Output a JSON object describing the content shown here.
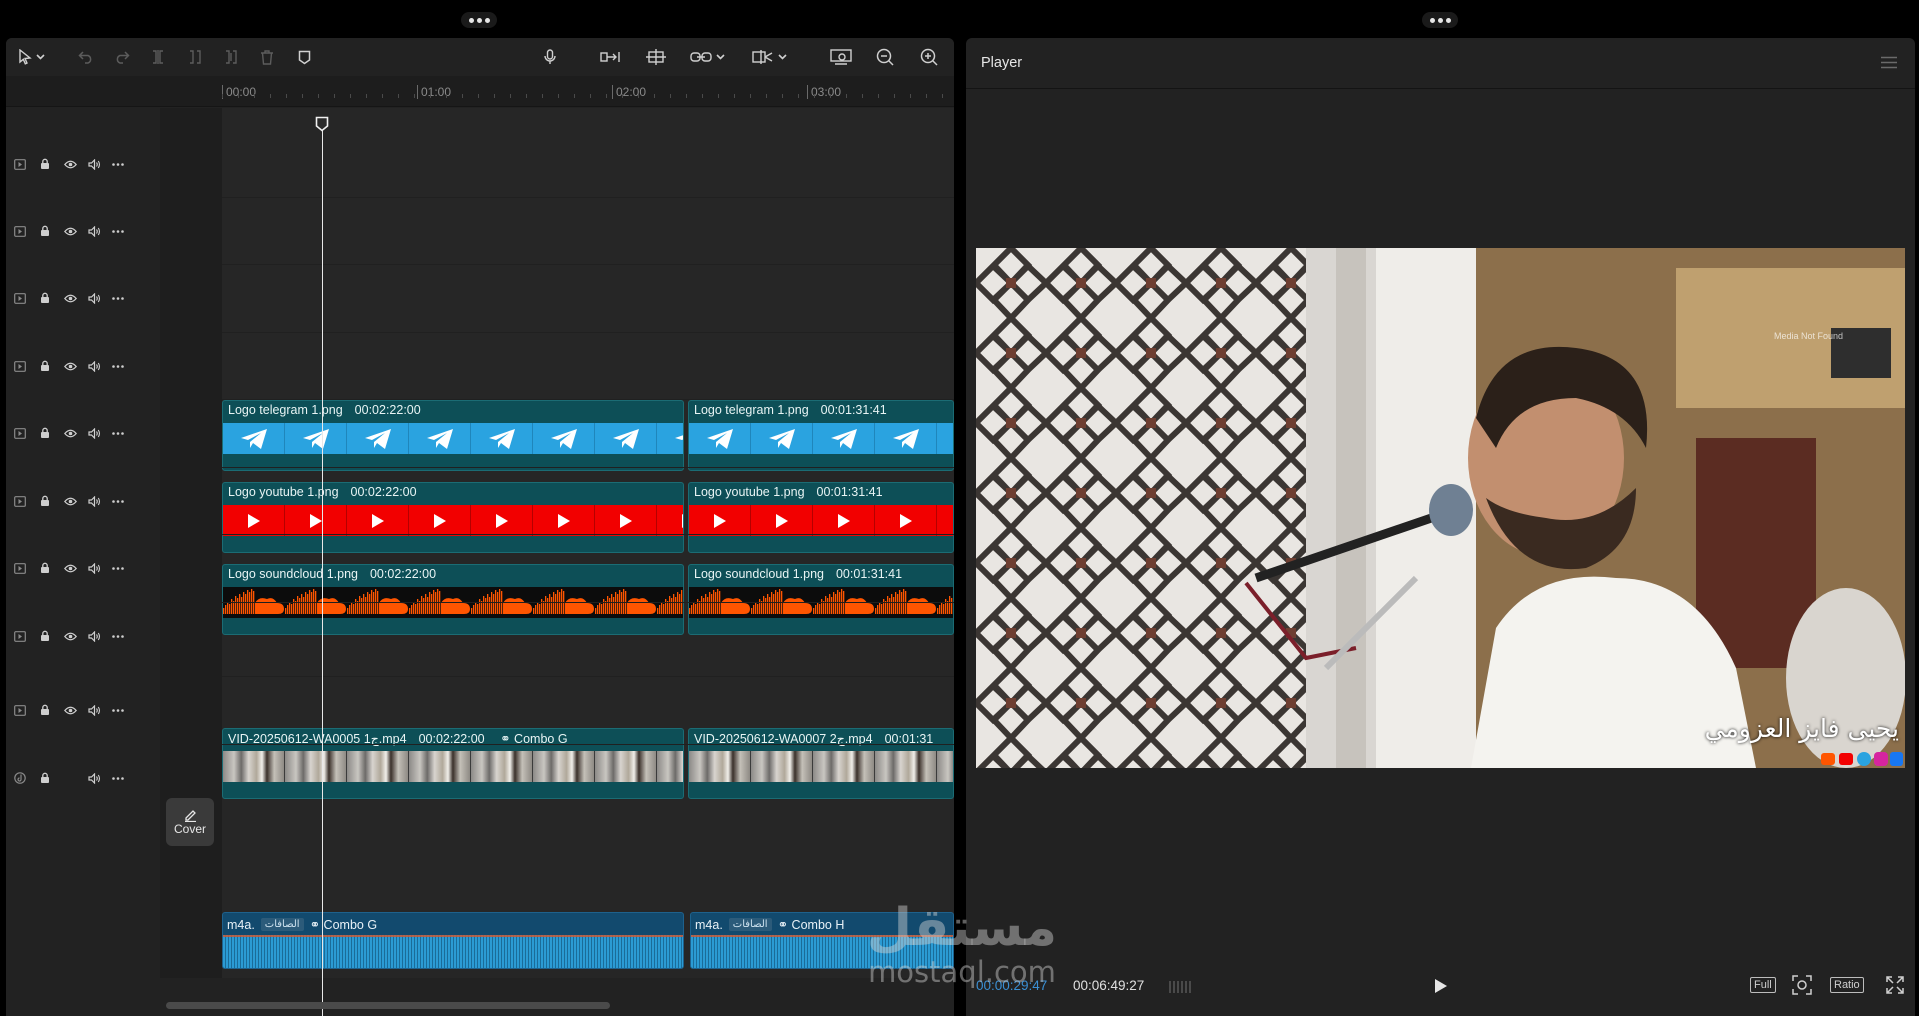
{
  "colors": {
    "accent": "#3a8fd4",
    "telegram": "#2aa3e0",
    "youtube": "#f20000",
    "soundcloud": "#ff5500",
    "clip_bg": "#0d4f57",
    "audio_bg": "#124a6e"
  },
  "toolbar": {
    "icons": [
      "select-tool-icon",
      "undo-icon",
      "redo-icon",
      "split-icon",
      "split-left-icon",
      "split-right-icon",
      "delete-icon",
      "marker-icon",
      "microphone-icon",
      "link-icon",
      "snap-icon",
      "chain-icon",
      "preview-icon",
      "zoom-fit-icon",
      "zoom-out-icon",
      "zoom-in-icon"
    ]
  },
  "ruler": {
    "ticks": [
      "00:00",
      "01:00",
      "02:00",
      "03:00"
    ]
  },
  "tracks": [
    {
      "row": 1
    },
    {
      "row": 2
    },
    {
      "row": 3
    },
    {
      "row": 4
    },
    {
      "row": 5
    },
    {
      "row": 6
    },
    {
      "row": 7
    },
    {
      "row": 8
    },
    {
      "row": 9
    },
    {
      "row": 10
    }
  ],
  "clips": {
    "telegram_a": {
      "name": "Logo telegram 1.png",
      "duration": "00:02:22:00"
    },
    "telegram_b": {
      "name": "Logo telegram 1.png",
      "duration": "00:01:31:41"
    },
    "youtube_a": {
      "name": "Logo youtube 1.png",
      "duration": "00:02:22:00"
    },
    "youtube_b": {
      "name": "Logo youtube 1.png",
      "duration": "00:01:31:41"
    },
    "soundcloud_a": {
      "name": "Logo soundcloud 1.png",
      "duration": "00:02:22:00"
    },
    "soundcloud_b": {
      "name": "Logo soundcloud 1.png",
      "duration": "00:01:31:41"
    },
    "video_a": {
      "name": "VID-20250612-WA0005 ج1.mp4",
      "duration": "00:02:22:00",
      "combo": "Combo G"
    },
    "video_b": {
      "name": "VID-20250612-WA0007 ج2.mp4",
      "duration": "00:01:31"
    },
    "audio_a": {
      "name": "m4a.",
      "tag": "الصافات",
      "combo": "Combo G"
    },
    "audio_b": {
      "name": "m4a.",
      "tag": "الصافات",
      "combo": "Combo H"
    }
  },
  "cover": {
    "label": "Cover"
  },
  "player": {
    "title": "Player",
    "current_time": "00:00:29:47",
    "total_time": "00:06:49:27",
    "buttons": {
      "full": "Full",
      "ratio": "Ratio"
    },
    "overlay_name": "يحيى فايز العزومي",
    "overlay_small": "Media Not Found"
  },
  "watermark": {
    "ar": "مستقل",
    "en": "mostaql.com"
  }
}
